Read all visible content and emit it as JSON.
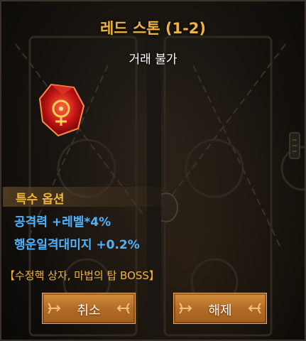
{
  "item": {
    "name": "레드 스톤 (1-2)",
    "trade_status": "거래 불가",
    "icon": "red-stone-gem-icon"
  },
  "special_options": {
    "header": "특수 옵션",
    "lines": [
      "공격력 +레벨*4%",
      "행운일격대미지 +0.2%"
    ]
  },
  "source_text": "【수정핵 상자, 마법의 탑 BOSS】",
  "buttons": {
    "cancel_label": "취소",
    "release_label": "해제"
  },
  "colors": {
    "title": "#f0b43e",
    "option_text": "#4fb3ff",
    "button": "#c07a2e",
    "background": "#14110d"
  }
}
